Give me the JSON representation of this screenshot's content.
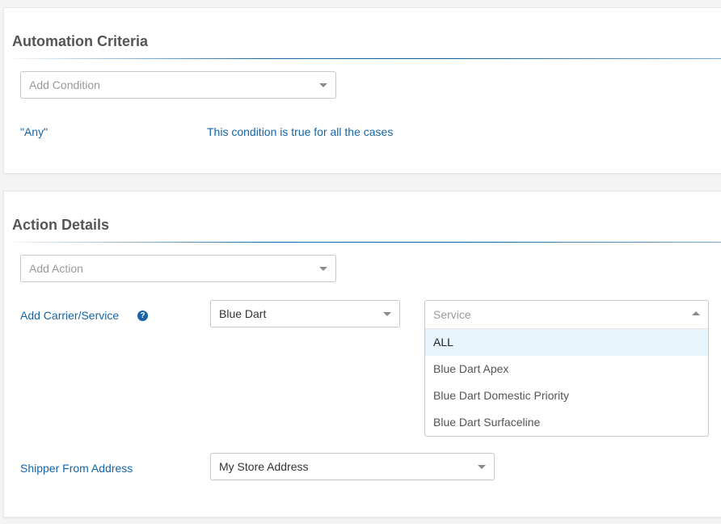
{
  "automation_criteria": {
    "title": "Automation Criteria",
    "add_condition_placeholder": "Add Condition",
    "condition_label": "\"Any\"",
    "condition_description": "This condition is true for all the cases"
  },
  "action_details": {
    "title": "Action Details",
    "add_action_placeholder": "Add Action",
    "carrier_service": {
      "label": "Add Carrier/Service",
      "help_icon": "question-circle-icon",
      "help_glyph": "?",
      "carrier_value": "Blue Dart",
      "service_placeholder": "Service",
      "service_options": [
        {
          "label": "ALL",
          "highlighted": true
        },
        {
          "label": "Blue Dart Apex",
          "highlighted": false
        },
        {
          "label": "Blue Dart Domestic Priority",
          "highlighted": false
        },
        {
          "label": "Blue Dart Surfaceline",
          "highlighted": false
        }
      ]
    },
    "shipper_from": {
      "label": "Shipper From Address",
      "value": "My Store Address"
    }
  },
  "colors": {
    "accent": "#1565a8",
    "title": "#555555",
    "highlight": "#e8f4fc"
  }
}
